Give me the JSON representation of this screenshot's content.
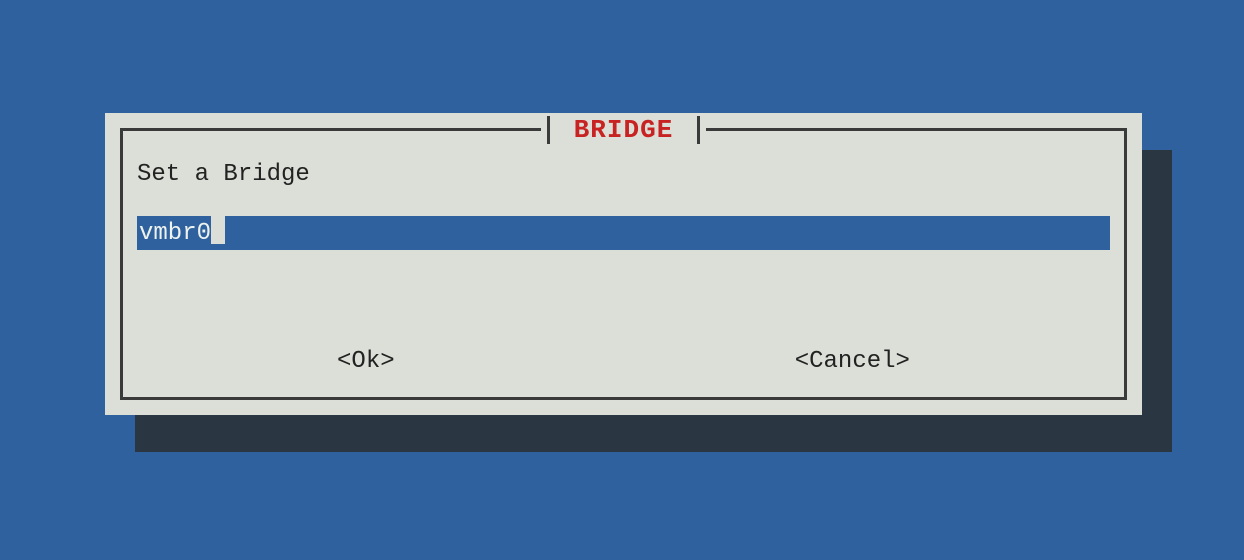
{
  "dialog": {
    "title": "BRIDGE",
    "prompt": "Set a Bridge",
    "input_value": "vmbr0",
    "buttons": {
      "ok": "<Ok>",
      "cancel": "<Cancel>"
    }
  },
  "colors": {
    "background": "#2e619e",
    "panel": "#dcdfd7",
    "shadow": "#2a3642",
    "title": "#c82323"
  }
}
